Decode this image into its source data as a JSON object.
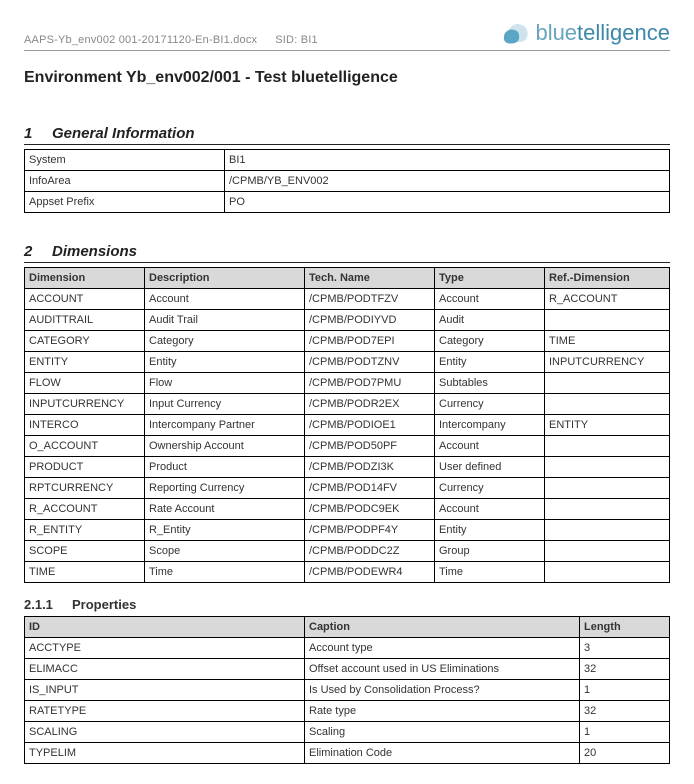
{
  "meta": {
    "filename": "AAPS-Yb_env002 001-20171120-En-BI1.docx",
    "sid_label": "SID: BI1"
  },
  "logo": {
    "text_light": "blue",
    "text_bold": "telligence"
  },
  "title": "Environment Yb_env002/001 - Test bluetelligence",
  "sections": {
    "general": {
      "num": "1",
      "label": "General Information",
      "rows": [
        {
          "k": "System",
          "v": "BI1"
        },
        {
          "k": "InfoArea",
          "v": "/CPMB/YB_ENV002"
        },
        {
          "k": "Appset Prefix",
          "v": "PO"
        }
      ]
    },
    "dimensions": {
      "num": "2",
      "label": "Dimensions",
      "headers": [
        "Dimension",
        "Description",
        "Tech. Name",
        "Type",
        "Ref.-Dimension"
      ],
      "rows": [
        [
          "ACCOUNT",
          "Account",
          "/CPMB/PODTFZV",
          "Account",
          "R_ACCOUNT"
        ],
        [
          "AUDITTRAIL",
          "Audit Trail",
          "/CPMB/PODIYVD",
          "Audit",
          ""
        ],
        [
          "CATEGORY",
          "Category",
          "/CPMB/POD7EPI",
          "Category",
          "TIME"
        ],
        [
          "ENTITY",
          "Entity",
          "/CPMB/PODTZNV",
          "Entity",
          "INPUTCURRENCY"
        ],
        [
          "FLOW",
          "Flow",
          "/CPMB/POD7PMU",
          "Subtables",
          ""
        ],
        [
          "INPUTCURRENCY",
          "Input Currency",
          "/CPMB/PODR2EX",
          "Currency",
          ""
        ],
        [
          "INTERCO",
          "Intercompany Partner",
          "/CPMB/PODIOE1",
          "Intercompany",
          "ENTITY"
        ],
        [
          "O_ACCOUNT",
          "Ownership Account",
          "/CPMB/POD50PF",
          "Account",
          ""
        ],
        [
          "PRODUCT",
          "Product",
          "/CPMB/PODZI3K",
          "User defined",
          ""
        ],
        [
          "RPTCURRENCY",
          "Reporting Currency",
          "/CPMB/POD14FV",
          "Currency",
          ""
        ],
        [
          "R_ACCOUNT",
          "Rate Account",
          "/CPMB/PODC9EK",
          "Account",
          ""
        ],
        [
          "R_ENTITY",
          "R_Entity",
          "/CPMB/PODPF4Y",
          "Entity",
          ""
        ],
        [
          "SCOPE",
          "Scope",
          "/CPMB/PODDC2Z",
          "Group",
          ""
        ],
        [
          "TIME",
          "Time",
          "/CPMB/PODEWR4",
          "Time",
          ""
        ]
      ]
    },
    "properties": {
      "num": "2.1.1",
      "label": "Properties",
      "headers": [
        "ID",
        "Caption",
        "Length"
      ],
      "rows": [
        [
          "ACCTYPE",
          "Account type",
          "3"
        ],
        [
          "ELIMACC",
          "Offset account used in US Eliminations",
          "32"
        ],
        [
          "IS_INPUT",
          "Is Used by Consolidation Process?",
          "1"
        ],
        [
          "RATETYPE",
          "Rate type",
          "32"
        ],
        [
          "SCALING",
          "Scaling",
          "1"
        ],
        [
          "TYPELIM",
          "Elimination Code",
          "20"
        ]
      ]
    }
  }
}
